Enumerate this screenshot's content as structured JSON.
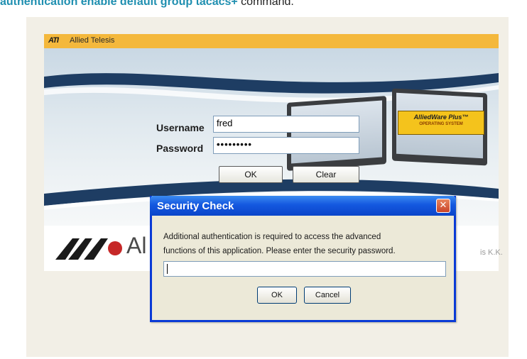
{
  "doc": {
    "heading_command": "authentication enable default group tacacs+",
    "heading_suffix": " command."
  },
  "login_window": {
    "title": "Allied Telesis",
    "username_label": "Username",
    "username_value": "fred",
    "password_label": "Password",
    "password_value": "•••••••••",
    "ok_label": "OK",
    "clear_label": "Clear",
    "badge_main": "AlliedWare Plus™",
    "badge_sub": "OPERATING SYSTEM",
    "brand_text": "Al",
    "company_suffix": "is K.K."
  },
  "dialog": {
    "title": "Security Check",
    "message_line1": "Additional authentication is required to access the advanced",
    "message_line2": "functions of this application. Please enter the security password.",
    "password_value": "",
    "ok_label": "OK",
    "cancel_label": "Cancel"
  },
  "colors": {
    "heading_blue": "#1f8fb0",
    "titlebar_yellow": "#f4b83c",
    "dialog_blue": "#0a3ad6",
    "close_red": "#c9442a"
  }
}
